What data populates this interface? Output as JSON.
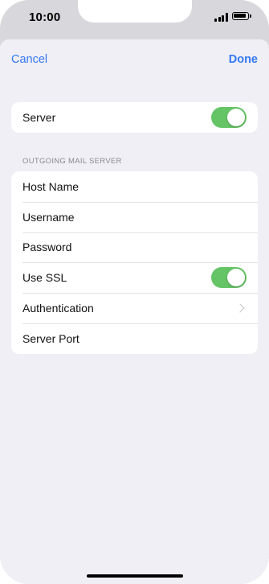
{
  "status_bar": {
    "time": "10:00",
    "icons": [
      "cellular-signal-icon",
      "battery-icon"
    ]
  },
  "nav": {
    "cancel_label": "Cancel",
    "done_label": "Done"
  },
  "server_group": {
    "server_label": "Server",
    "server_enabled": true
  },
  "outgoing": {
    "section_header": "OUTGOING MAIL SERVER",
    "rows": {
      "host_name": "Host Name",
      "username": "Username",
      "password": "Password",
      "use_ssl": "Use SSL",
      "authentication": "Authentication",
      "server_port": "Server Port"
    },
    "use_ssl_enabled": true
  },
  "colors": {
    "accent": "#3478f6",
    "toggle_on": "#65c466",
    "background": "#f0eff5"
  }
}
